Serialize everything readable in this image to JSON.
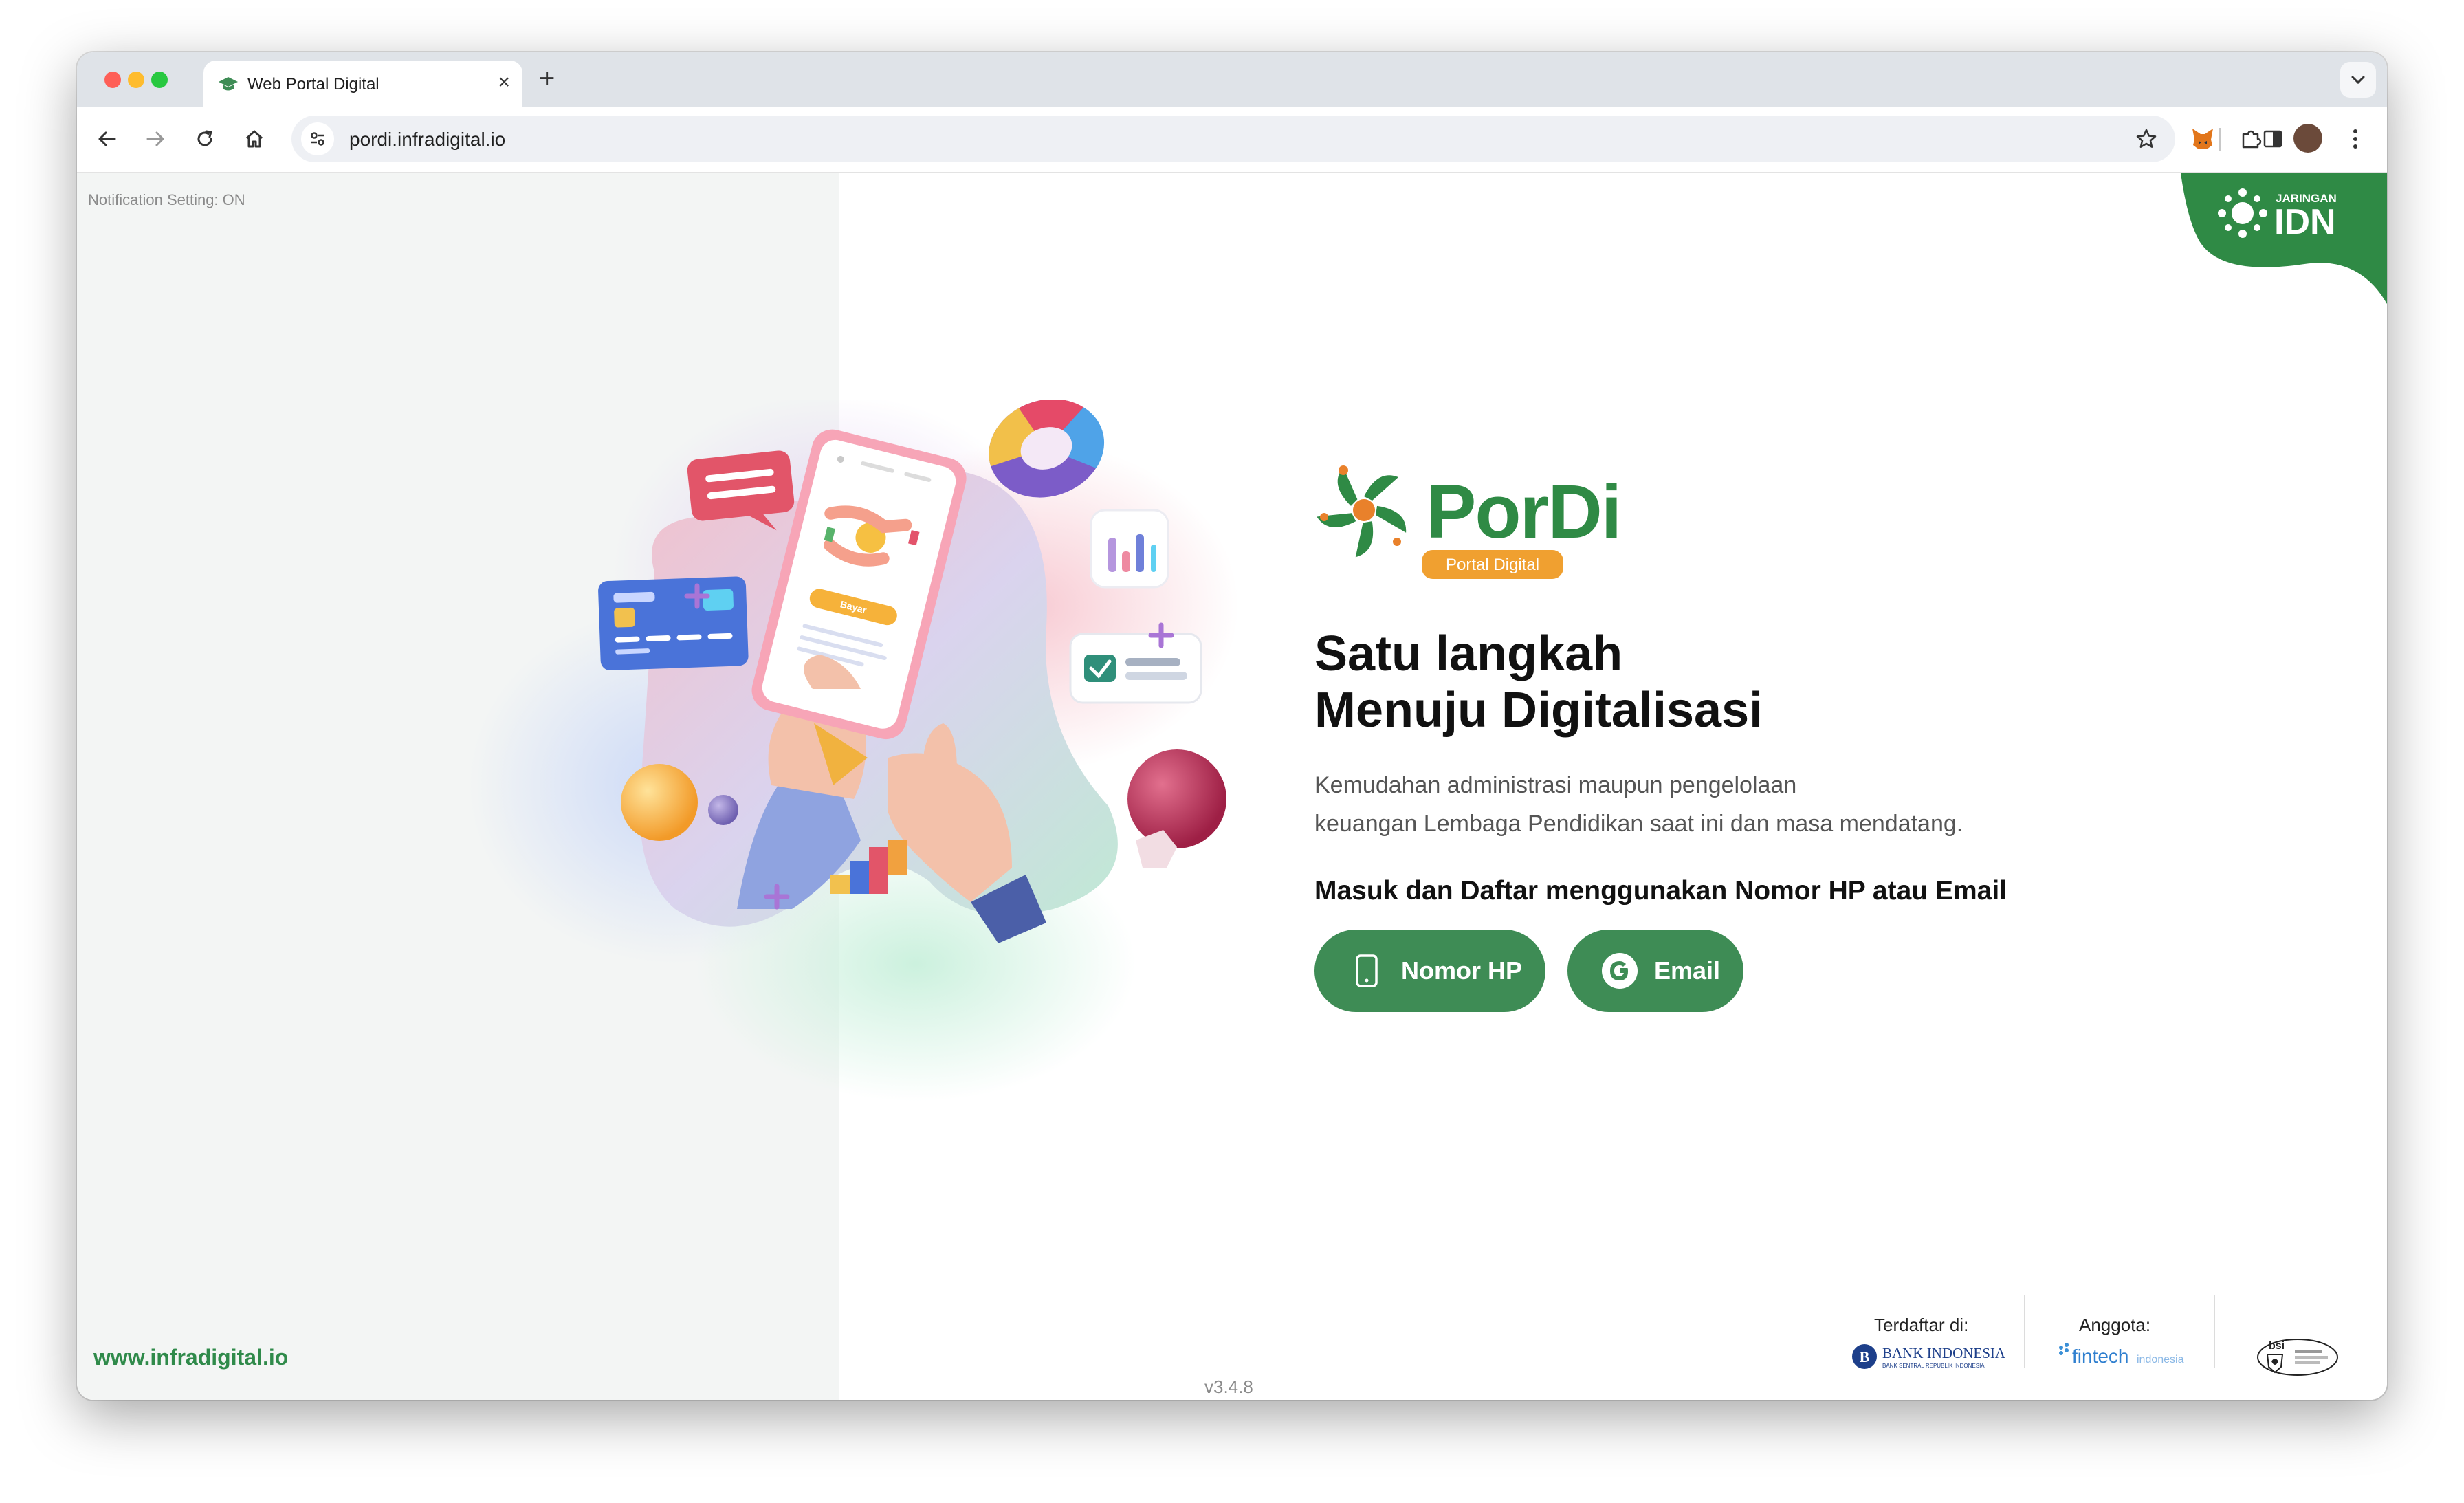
{
  "browser": {
    "tab_title": "Web Portal Digital",
    "url": "pordi.infradigital.io",
    "icons": [
      "graduation-cap-icon",
      "close-icon",
      "plus-icon",
      "chevron-down-icon",
      "arrow-left-icon",
      "arrow-right-icon",
      "reload-icon",
      "home-icon",
      "tune-icon",
      "star-icon",
      "metamask-fox-icon",
      "puzzle-icon",
      "sidebar-icon",
      "kebab-menu-icon"
    ]
  },
  "page": {
    "notification_status": "Notification Setting: ON",
    "website": "www.infradigital.io",
    "version": "v3.4.8",
    "corner_brand": {
      "small": "JARINGAN",
      "large": "IDN"
    },
    "logo": {
      "name": "PorDi",
      "tagline": "Portal Digital"
    },
    "headline": [
      "Satu langkah",
      "Menuju Digitalisasi"
    ],
    "description": [
      "Kemudahan administrasi maupun pengelolaan",
      "keuangan Lembaga Pendidikan saat ini dan masa mendatang."
    ],
    "cta": "Masuk dan Daftar menggunakan Nomor HP atau Email",
    "buttons": {
      "phone": "Nomor HP",
      "email": "Email"
    },
    "illustration": {
      "pay_label": "Bayar"
    },
    "footer": {
      "registered_label": "Terdaftar di:",
      "registered_name": "BANK INDONESIA",
      "registered_sub": "BANK SENTRAL REPUBLIK INDONESIA",
      "member_label": "Anggota:",
      "member_name": "fintech",
      "member_sub": "indonesia",
      "cert_name": "bsi"
    }
  },
  "colors": {
    "brand_green": "#3e8c55",
    "brand_orange": "#f0a030",
    "text_dark": "#111111"
  }
}
